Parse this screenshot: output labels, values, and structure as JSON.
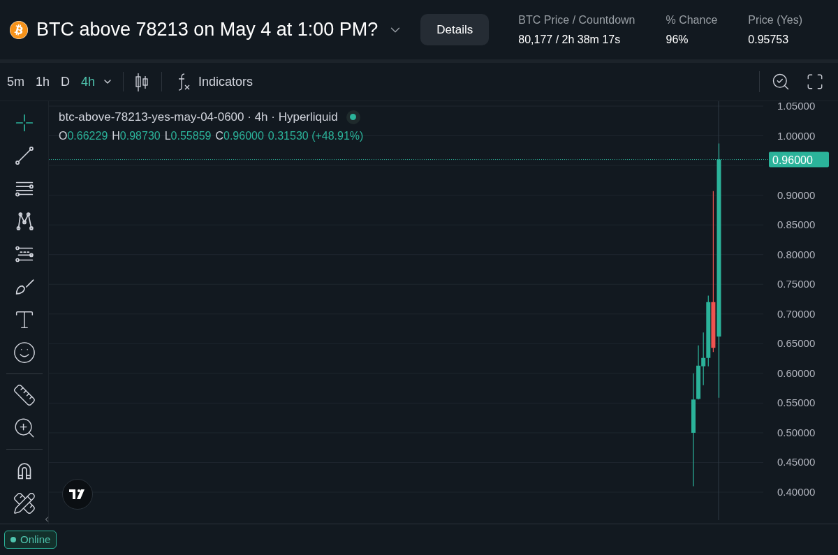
{
  "market": {
    "title": "BTC above 78213 on May 4 at 1:00 PM?",
    "details_button": "Details",
    "stats": [
      {
        "label": "BTC Price / Countdown",
        "value": "80,177 / 2h 38m 17s"
      },
      {
        "label": "% Chance",
        "value": "96%"
      },
      {
        "label": "Price (Yes)",
        "value": "0.95753"
      }
    ]
  },
  "toolbar": {
    "intervals": [
      {
        "label": "5m",
        "selected": false
      },
      {
        "label": "1h",
        "selected": false
      },
      {
        "label": "D",
        "selected": false
      },
      {
        "label": "4h",
        "selected": true
      }
    ],
    "indicators": "Indicators"
  },
  "legend": {
    "symbol": "btc-above-78213-yes-may-04-0600 · 4h · Hyperliquid",
    "ohlc": [
      {
        "key": "O",
        "value": "0.66229"
      },
      {
        "key": "H",
        "value": "0.98730"
      },
      {
        "key": "L",
        "value": "0.55859"
      },
      {
        "key": "C",
        "value": "0.96000"
      }
    ],
    "change": "0.31530 (+48.91%)"
  },
  "chart": {
    "last_price_label": "0.96000",
    "price_axis": [
      "1.05000",
      "1.00000",
      "0.90000",
      "0.85000",
      "0.80000",
      "0.75000",
      "0.70000",
      "0.65000",
      "0.60000",
      "0.55000",
      "0.50000",
      "0.45000",
      "0.40000"
    ]
  },
  "status": {
    "label": "Online"
  }
}
